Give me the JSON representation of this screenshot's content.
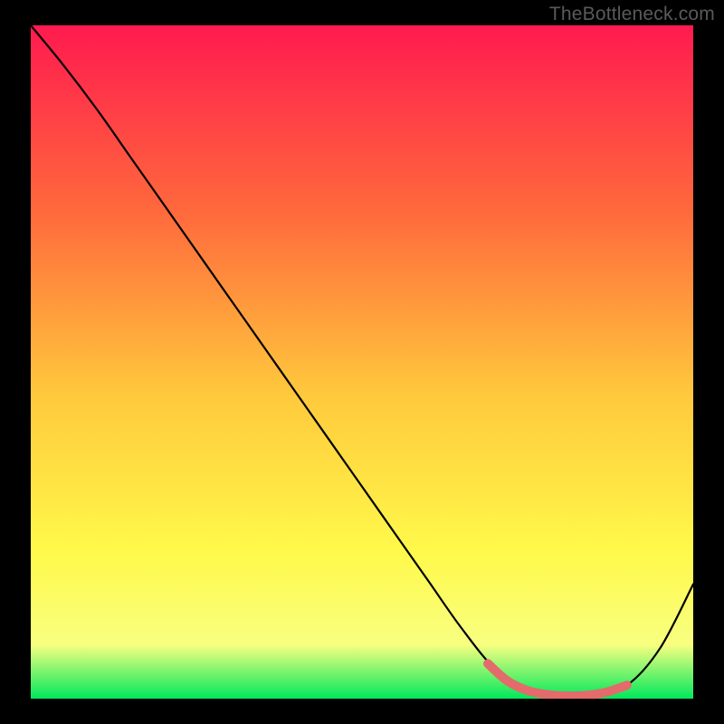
{
  "watermark": "TheBottleneck.com",
  "colors": {
    "background": "#000000",
    "gradient_top": "#ff1a4f",
    "gradient_mid1": "#ff6a3c",
    "gradient_mid2": "#ffc93c",
    "gradient_mid3": "#fff94a",
    "gradient_mid4": "#f8ff80",
    "gradient_bottom": "#00e85c",
    "curve": "#000000",
    "highlight": "#e46b6b"
  },
  "chart_data": {
    "type": "line",
    "title": "",
    "xlabel": "",
    "ylabel": "",
    "xlim": [
      0,
      100
    ],
    "ylim": [
      0,
      100
    ],
    "grid": false,
    "series": [
      {
        "name": "bottleneck-curve",
        "x": [
          0,
          5,
          10,
          15,
          20,
          25,
          30,
          35,
          40,
          45,
          50,
          55,
          60,
          65,
          70,
          75,
          80,
          85,
          90,
          95,
          100
        ],
        "y": [
          100,
          94,
          87.5,
          80.5,
          73.5,
          66.5,
          59.5,
          52.5,
          45.5,
          38.5,
          31.5,
          24.5,
          17.5,
          10.5,
          4.5,
          1.2,
          0.4,
          0.6,
          2.0,
          7.5,
          17.0
        ]
      },
      {
        "name": "sweet-spot-highlight",
        "x": [
          69,
          72,
          75,
          78,
          81,
          84,
          87,
          90
        ],
        "y": [
          5.2,
          2.6,
          1.2,
          0.6,
          0.4,
          0.5,
          1.0,
          2.0
        ]
      }
    ],
    "annotations": []
  }
}
